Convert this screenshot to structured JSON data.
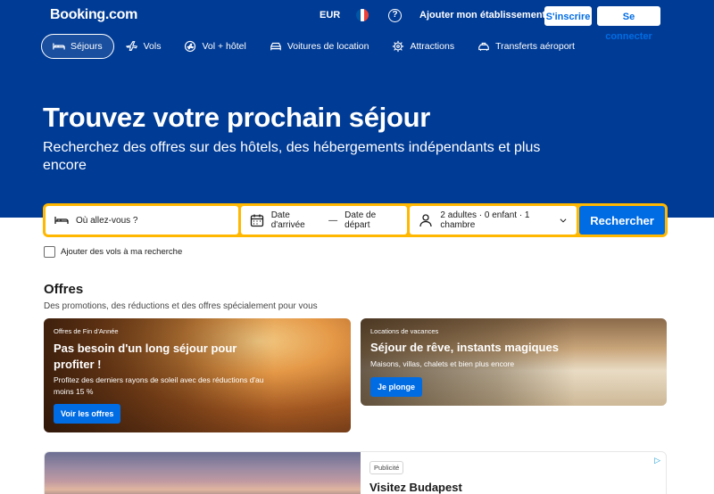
{
  "header": {
    "logo": "Booking.com",
    "currency": "EUR",
    "help_glyph": "?",
    "list_property": "Ajouter mon établissement",
    "register": "S'inscrire",
    "sign_in": "Se connecter",
    "flag_colors": [
      "#0055a4",
      "#ffffff",
      "#ef4135"
    ]
  },
  "nav": {
    "items": [
      {
        "label": "Séjours",
        "icon": "bed-icon",
        "active": true
      },
      {
        "label": "Vols",
        "icon": "plane-icon",
        "active": false
      },
      {
        "label": "Vol + hôtel",
        "icon": "plane-hotel-icon",
        "active": false
      },
      {
        "label": "Voitures de location",
        "icon": "car-icon",
        "active": false
      },
      {
        "label": "Attractions",
        "icon": "attractions-icon",
        "active": false
      },
      {
        "label": "Transferts aéroport",
        "icon": "taxi-icon",
        "active": false
      }
    ]
  },
  "hero": {
    "title": "Trouvez votre prochain séjour",
    "subtitle": "Recherchez des offres sur des hôtels, des hébergements indépendants et plus encore"
  },
  "search": {
    "destination_placeholder": "Où allez-vous ?",
    "checkin": "Date d'arrivée",
    "date_separator": "—",
    "checkout": "Date de départ",
    "guests": "2 adultes · 0 enfant · 1 chambre",
    "submit": "Rechercher",
    "add_flights": "Ajouter des vols à ma recherche"
  },
  "offers": {
    "title": "Offres",
    "subtitle": "Des promotions, des réductions et des offres spécialement pour vous",
    "cards": [
      {
        "tag": "Offres de Fin d'Année",
        "title": "Pas besoin d'un long séjour pour profiter !",
        "description": "Profitez des derniers rayons de soleil avec des réductions d'au moins 15 %",
        "button": "Voir les offres"
      },
      {
        "tag": "Locations de vacances",
        "title": "Séjour de rêve, instants magiques",
        "description": "Maisons, villas, chalets et bien plus encore",
        "button": "Je plonge"
      }
    ]
  },
  "ad": {
    "badge": "Publicité",
    "title": "Visitez Budapest",
    "choice_icon": "▷"
  },
  "colors": {
    "brand_blue": "#003b95",
    "action_blue": "#006ce4",
    "search_border": "#ffb700"
  }
}
